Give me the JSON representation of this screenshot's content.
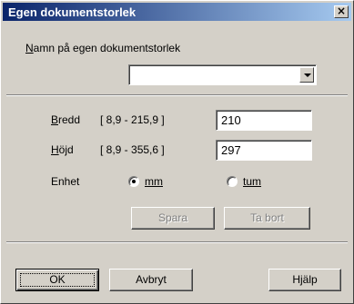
{
  "window": {
    "title": "Egen dokumentstorlek",
    "close_glyph": "×"
  },
  "name_field": {
    "label_pre": "",
    "label_accel": "N",
    "label_post": "amn på egen dokumentstorlek",
    "value": ""
  },
  "width": {
    "label_accel": "B",
    "label_post": "redd",
    "range": "[  8,9  -  215,9 ]",
    "value": "210"
  },
  "height": {
    "label_accel": "H",
    "label_post": "öjd",
    "range": "[  8,9  -  355,6 ]",
    "value": "297"
  },
  "unit": {
    "label": "Enhet",
    "options": [
      {
        "label": "mm",
        "selected": true
      },
      {
        "label": "tum",
        "selected": false
      }
    ]
  },
  "buttons": {
    "save": "Spara",
    "remove": "Ta bort",
    "ok": "OK",
    "cancel": "Avbryt",
    "help": "Hjälp"
  },
  "colors": {
    "face": "#d4d0c8",
    "title_start": "#0a246a",
    "title_end": "#a6caf0"
  }
}
